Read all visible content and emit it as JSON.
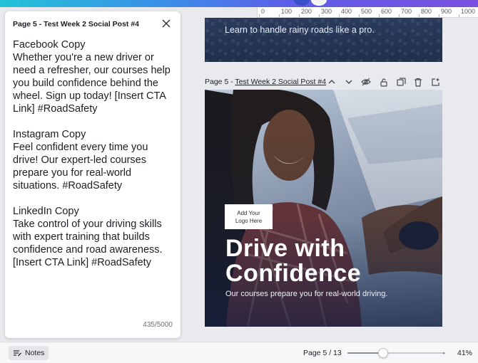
{
  "ruler": {
    "marks": [
      "0",
      "100",
      "200",
      "300",
      "400",
      "500",
      "600",
      "700",
      "800",
      "900",
      "1000"
    ]
  },
  "notes_panel": {
    "title": "Page 5 - Test Week 2 Social Post #4",
    "sections": [
      "Facebook Copy\nWhether you're a new driver or need a refresher, our courses help you build confidence behind the wheel. Sign up today! [Insert CTA Link] #RoadSafety",
      "Instagram Copy\nFeel confident every time you drive! Our expert-led courses prepare you for real-world situations. #RoadSafety",
      "LinkedIn Copy\nTake control of your driving skills with expert training that builds confidence and road awareness. [Insert CTA Link] #RoadSafety"
    ],
    "char_count": "435/5000"
  },
  "previous_page": {
    "caption": "Learn to handle rainy roads like a pro."
  },
  "page_header": {
    "title_prefix": "Page 5 - ",
    "title_linked": "Test Week 2 Social Post #4",
    "icons": [
      "chevron-up-icon",
      "chevron-down-icon",
      "hide-icon",
      "lock-icon",
      "duplicate-icon",
      "trash-icon",
      "add-page-icon"
    ]
  },
  "design": {
    "logo_placeholder": "Add Your\nLogo Here",
    "headline": "Drive with\nConfidence",
    "subline": "Our courses prepare you for real-world driving."
  },
  "bottom_bar": {
    "notes_label": "Notes",
    "page_indicator": "Page 5 / 13",
    "zoom_label": "41%",
    "zoom_fraction": 0.37
  },
  "colors": {
    "accent_gradient_start": "#23c3d6",
    "accent_gradient_end": "#7b4fe0",
    "design_navy": "#1b2a4d"
  }
}
